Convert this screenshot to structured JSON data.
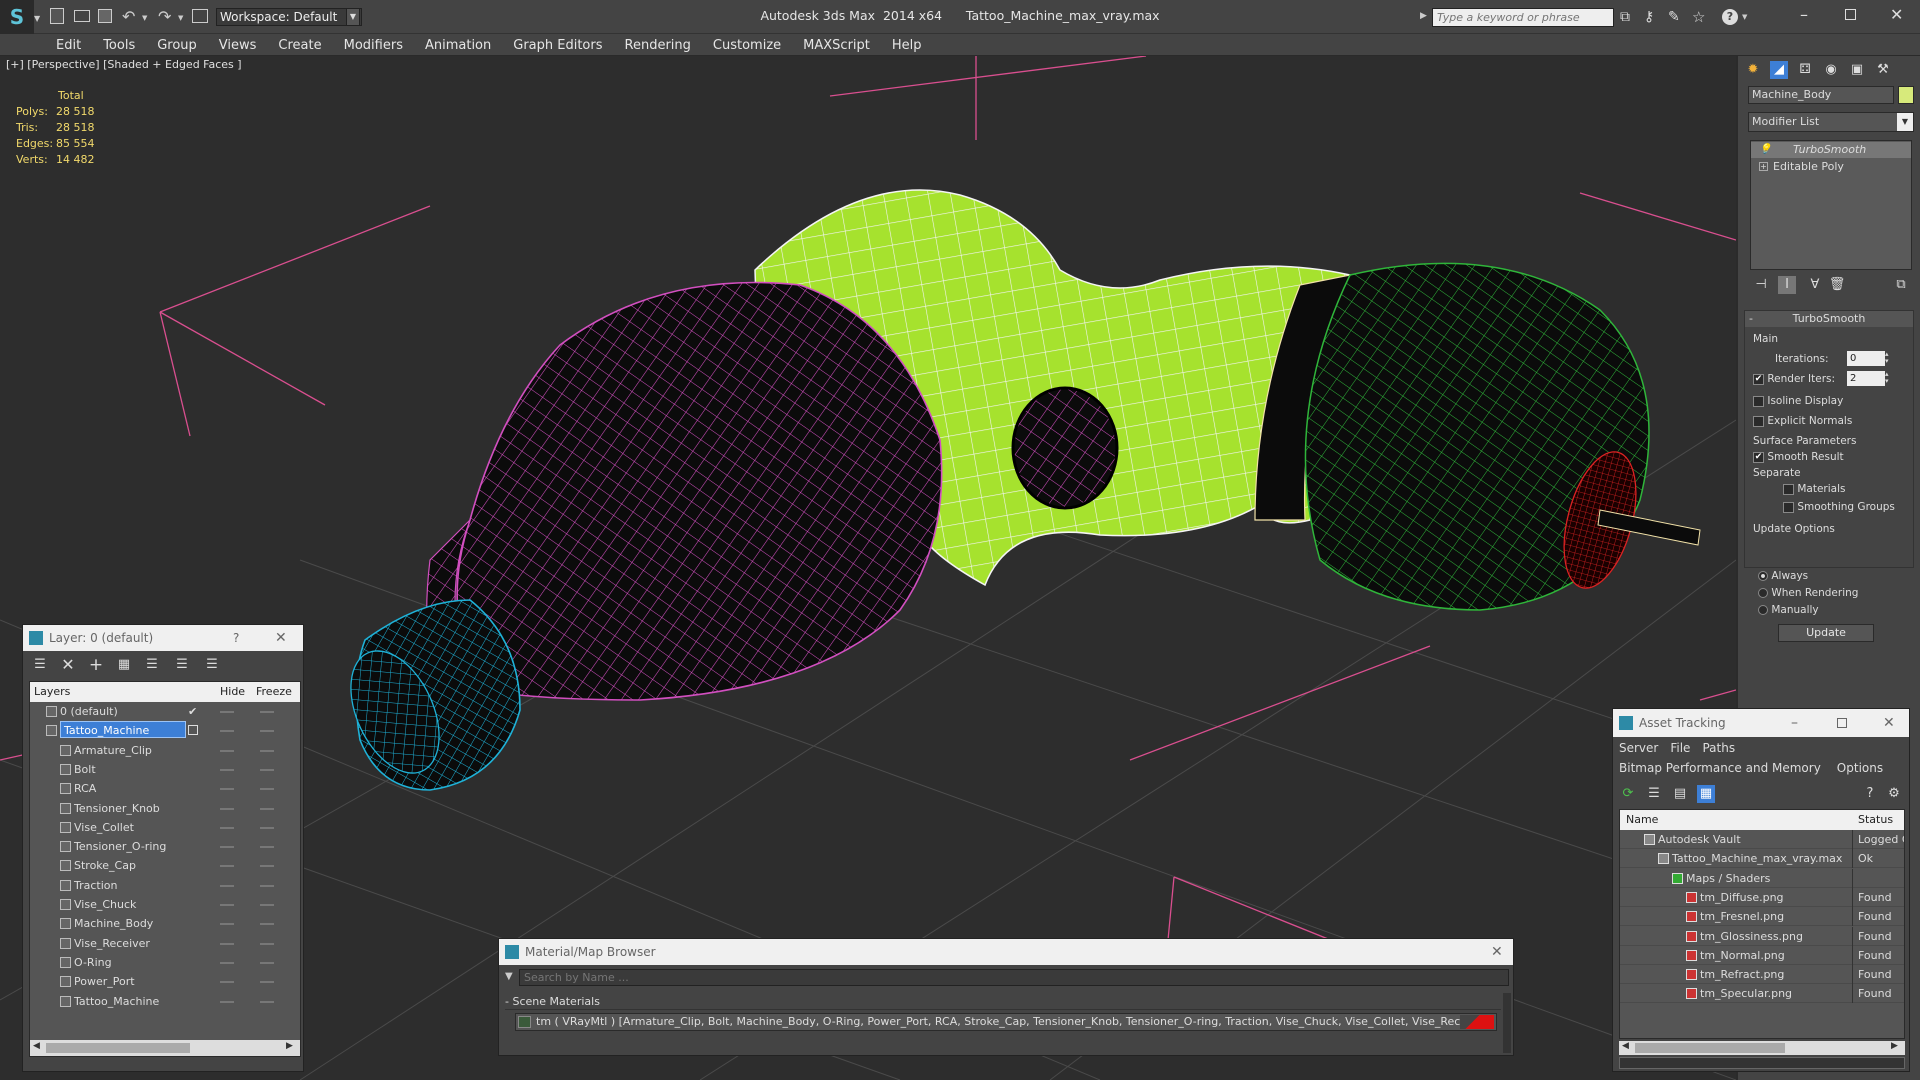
{
  "titlebar": {
    "title": "Autodesk 3ds Max  2014 x64      Tattoo_Machine_max_vray.max",
    "workspace": "Workspace: Default",
    "search_placeholder": "Type a keyword or phrase"
  },
  "menu": [
    "Edit",
    "Tools",
    "Group",
    "Views",
    "Create",
    "Modifiers",
    "Animation",
    "Graph Editors",
    "Rendering",
    "Customize",
    "MAXScript",
    "Help"
  ],
  "viewport": {
    "label": "[+] [Perspective] [Shaded + Edged Faces ]",
    "stats": {
      "header": "Total",
      "rows": [
        {
          "label": "Polys:",
          "value": "28 518"
        },
        {
          "label": "Tris:",
          "value": "28 518"
        },
        {
          "label": "Edges:",
          "value": "85 554"
        },
        {
          "label": "Verts:",
          "value": "14 482"
        }
      ]
    }
  },
  "command_panel": {
    "object_name": "Machine_Body",
    "modifier_list": "Modifier List",
    "stack": [
      "TurboSmooth",
      "Editable Poly"
    ],
    "rollout_title": "TurboSmooth",
    "main_label": "Main",
    "iterations_label": "Iterations:",
    "iterations_value": "0",
    "render_iters_label": "Render Iters:",
    "render_iters_value": "2",
    "isoline": "Isoline Display",
    "explicit_normals": "Explicit Normals",
    "surface_params": "Surface Parameters",
    "smooth_result": "Smooth Result",
    "separate": "Separate",
    "materials": "Materials",
    "smoothing_groups": "Smoothing Groups",
    "update_options": "Update Options",
    "always": "Always",
    "when_rendering": "When Rendering",
    "manually": "Manually",
    "update_button": "Update"
  },
  "layer_panel": {
    "title": "Layer: 0 (default)",
    "help": "?",
    "col_layers": "Layers",
    "col_hide": "Hide",
    "col_freeze": "Freeze",
    "default_layer": "0 (default)",
    "active_layer": "Tattoo_Machine",
    "objects": [
      "Armature_Clip",
      "Bolt",
      "RCA",
      "Tensioner_Knob",
      "Vise_Collet",
      "Tensioner_O-ring",
      "Stroke_Cap",
      "Traction",
      "Vise_Chuck",
      "Machine_Body",
      "Vise_Receiver",
      "O-Ring",
      "Power_Port",
      "Tattoo_Machine"
    ]
  },
  "material_browser": {
    "title": "Material/Map Browser",
    "search_placeholder": "Search by Name ...",
    "group": "Scene Materials",
    "material": "tm  ( VRayMtl ) [Armature_Clip, Bolt, Machine_Body, O-Ring, Power_Port, RCA, Stroke_Cap, Tensioner_Knob, Tensioner_O-ring, Traction, Vise_Chuck, Vise_Collet, Vise_Receiver]"
  },
  "asset_tracking": {
    "title": "Asset Tracking",
    "menu1": [
      "Server",
      "File",
      "Paths"
    ],
    "menu2": [
      "Bitmap Performance and Memory",
      "Options"
    ],
    "col_name": "Name",
    "col_status": "Status",
    "rows": [
      {
        "name": "Autodesk Vault",
        "status": "Logged C",
        "indent": 1,
        "icon": "vault"
      },
      {
        "name": "Tattoo_Machine_max_vray.max",
        "status": "Ok",
        "indent": 2,
        "icon": "max"
      },
      {
        "name": "Maps / Shaders",
        "status": "",
        "indent": 3,
        "icon": "folder"
      },
      {
        "name": "tm_Diffuse.png",
        "status": "Found",
        "indent": 4,
        "icon": "png"
      },
      {
        "name": "tm_Fresnel.png",
        "status": "Found",
        "indent": 4,
        "icon": "png"
      },
      {
        "name": "tm_Glossiness.png",
        "status": "Found",
        "indent": 4,
        "icon": "png"
      },
      {
        "name": "tm_Normal.png",
        "status": "Found",
        "indent": 4,
        "icon": "png"
      },
      {
        "name": "tm_Refract.png",
        "status": "Found",
        "indent": 4,
        "icon": "png"
      },
      {
        "name": "tm_Specular.png",
        "status": "Found",
        "indent": 4,
        "icon": "png"
      }
    ]
  },
  "colors": {
    "green": "#a6e22e",
    "pink": "#d24fc0",
    "cyan": "#1fb2d8",
    "dark_green": "#2fb53a",
    "grid": "#d94f8f",
    "selection": "#3d7fd6"
  }
}
